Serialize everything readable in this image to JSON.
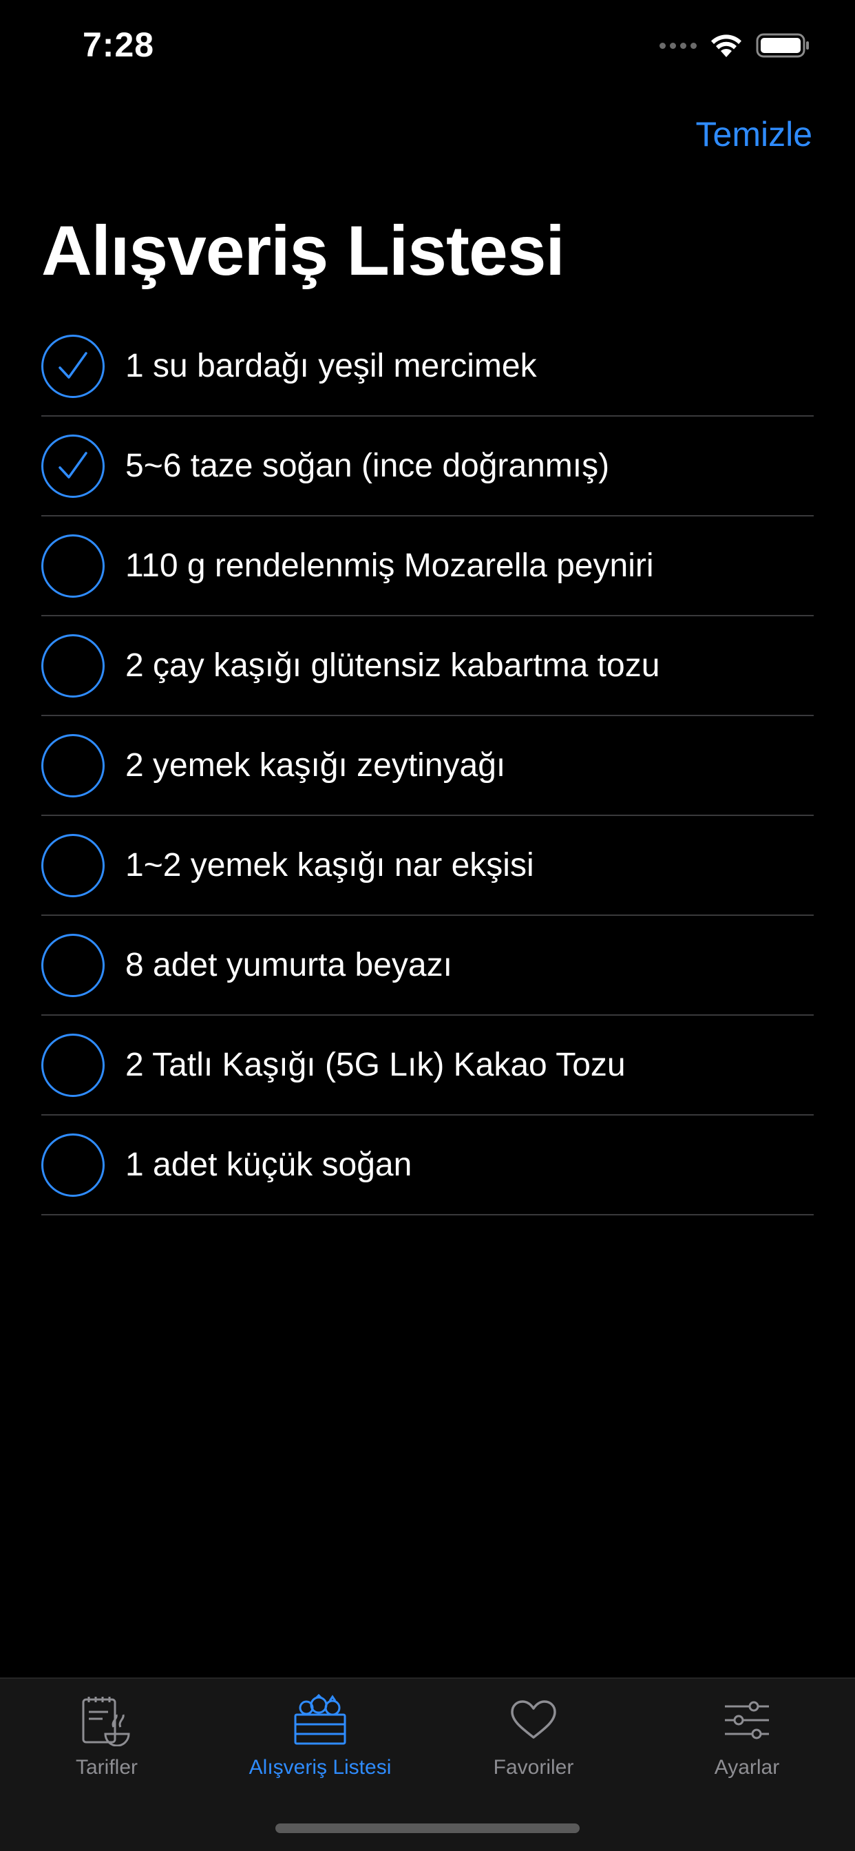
{
  "status": {
    "time": "7:28"
  },
  "nav": {
    "action_label": "Temizle"
  },
  "page": {
    "title": "Alışveriş Listesi"
  },
  "items": [
    {
      "label": "1 su bardağı yeşil mercimek",
      "checked": true
    },
    {
      "label": "5~6 taze soğan (ince doğranmış)",
      "checked": true
    },
    {
      "label": "110 g rendelenmiş Mozarella peyniri",
      "checked": false
    },
    {
      "label": "2 çay kaşığı glütensiz kabartma tozu",
      "checked": false
    },
    {
      "label": "2 yemek kaşığı zeytinyağı",
      "checked": false
    },
    {
      "label": "1~2 yemek kaşığı nar ekşisi",
      "checked": false
    },
    {
      "label": "8 adet yumurta beyazı",
      "checked": false
    },
    {
      "label": "2 Tatlı Kaşığı (5G Lık) Kakao Tozu",
      "checked": false
    },
    {
      "label": "1 adet küçük soğan",
      "checked": false
    }
  ],
  "tabs": [
    {
      "label": "Tarifler",
      "icon": "recipe-book-icon",
      "active": false
    },
    {
      "label": "Alışveriş Listesi",
      "icon": "vegetable-crate-icon",
      "active": true
    },
    {
      "label": "Favoriler",
      "icon": "heart-icon",
      "active": false
    },
    {
      "label": "Ayarlar",
      "icon": "sliders-icon",
      "active": false
    }
  ],
  "colors": {
    "accent": "#2f8cff",
    "inactive": "#8e8e93",
    "background": "#000000",
    "tab_bar": "#161616"
  }
}
